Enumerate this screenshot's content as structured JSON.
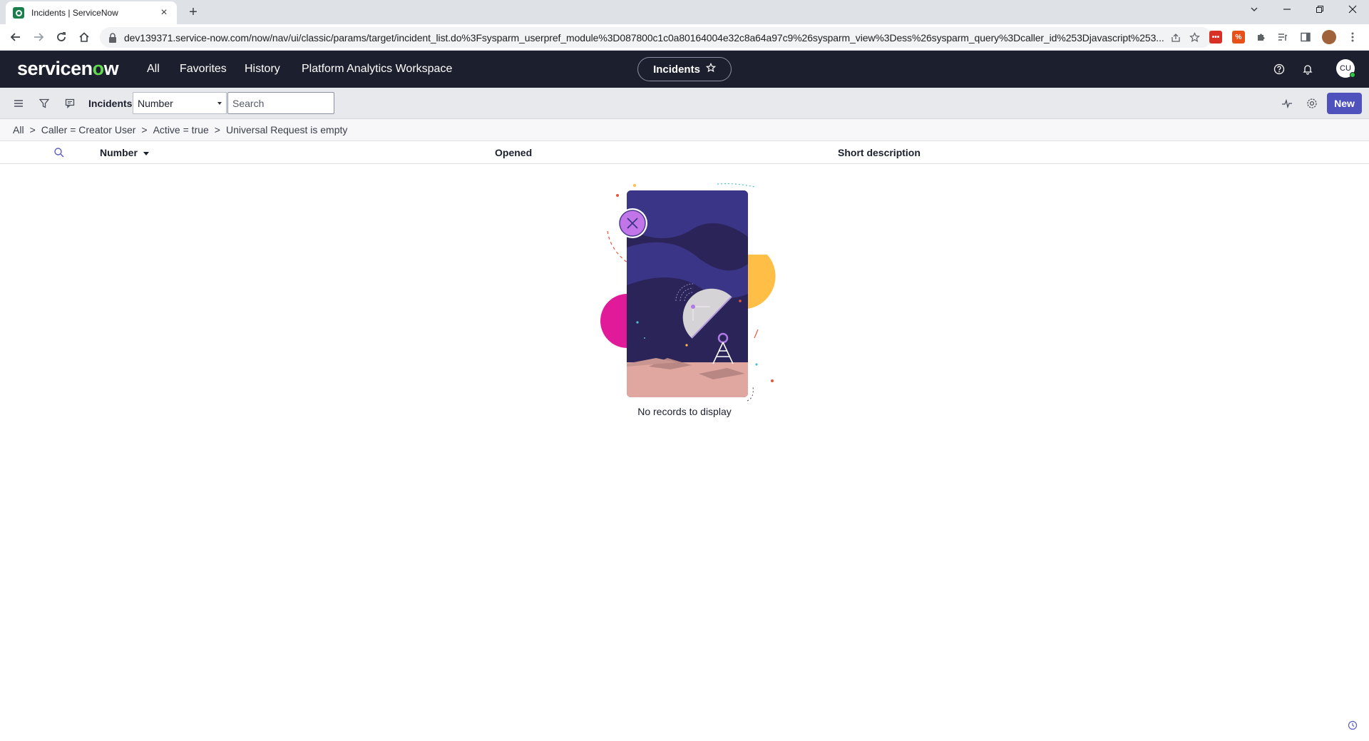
{
  "browser": {
    "tab_title": "Incidents | ServiceNow",
    "new_tab_label": "+",
    "url": "dev139371.service-now.com/now/nav/ui/classic/params/target/incident_list.do%3Fsysparm_userpref_module%3D087800c1c0a80164004e32c8a64a97c9%26sysparm_view%3Dess%26sysparm_query%3Dcaller_id%253Djavascript%253..."
  },
  "header": {
    "logo_prefix": "servicen",
    "logo_o": "o",
    "logo_suffix": "w",
    "nav": [
      "All",
      "Favorites",
      "History",
      "Platform Analytics Workspace"
    ],
    "context_pill": "Incidents",
    "avatar_initials": "CU"
  },
  "toolbar": {
    "title": "Incidents",
    "field_select": "Number",
    "search_placeholder": "Search",
    "new_label": "New"
  },
  "breadcrumb": [
    "All",
    "Caller = Creator User",
    "Active = true",
    "Universal Request is empty"
  ],
  "columns": [
    "Number",
    "Opened",
    "Short description"
  ],
  "empty_state": {
    "message": "No records to display"
  },
  "colors": {
    "header_bg": "#1c1f2e",
    "accent": "#4f52bd",
    "logo_accent": "#62d84e"
  }
}
